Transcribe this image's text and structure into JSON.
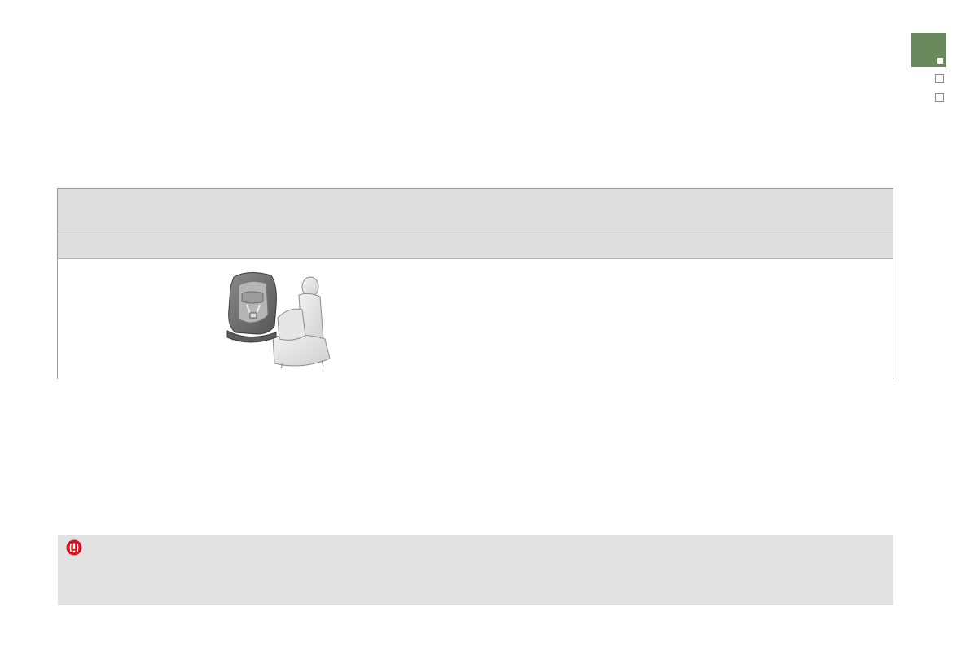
{
  "colors": {
    "tab_active": "#6a8a5e",
    "table_header_bg": "#dedede",
    "warning_bg": "#e2e2e2",
    "warning_icon": "#d6101f"
  },
  "section_tabs": {
    "active_index": 0,
    "count": 3
  },
  "icons": {
    "warning": "warning-exclamation-icon",
    "illustration": "child-seat-illustration"
  },
  "seat_table": {
    "header": "",
    "subheader": "",
    "body_text": ""
  },
  "warning": {
    "text": ""
  }
}
